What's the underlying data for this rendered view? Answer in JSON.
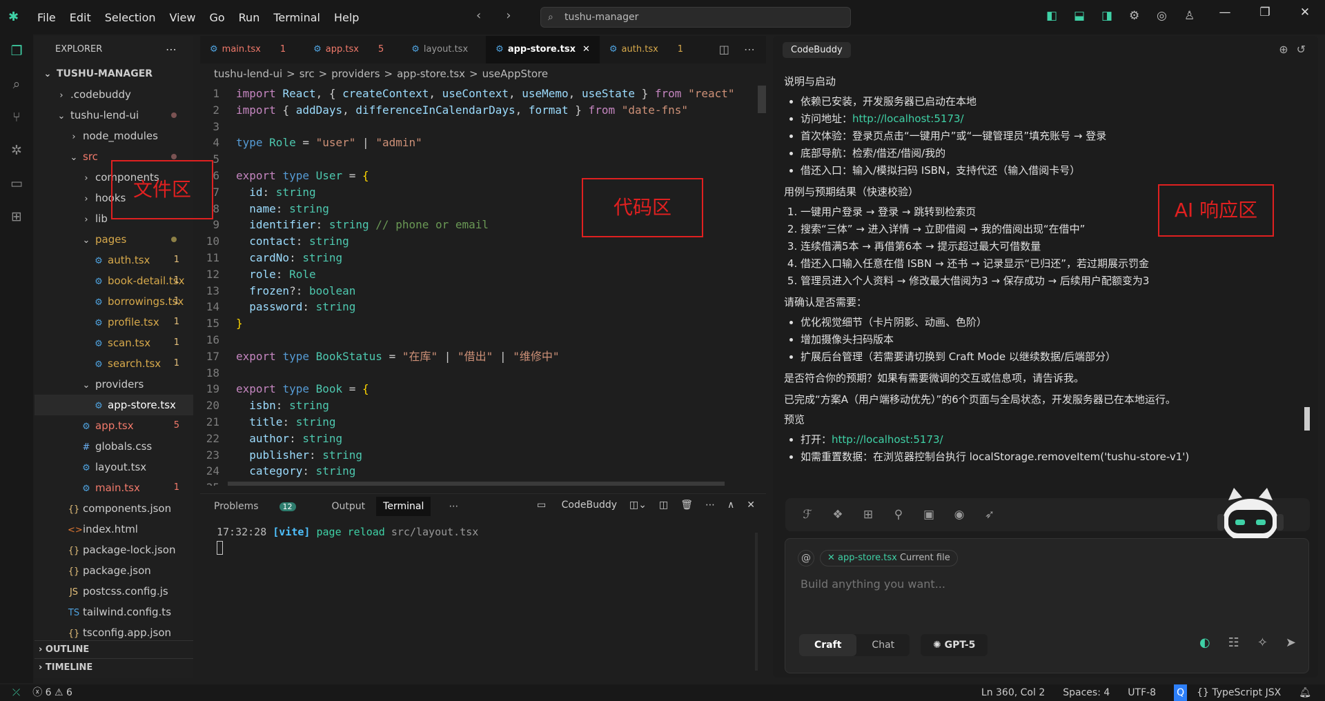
{
  "window": {
    "search": "tushu-manager",
    "menu": [
      "File",
      "Edit",
      "Selection",
      "View",
      "Go",
      "Run",
      "Terminal",
      "Help"
    ]
  },
  "explorer": {
    "header": "EXPLORER",
    "root": "TUSHU-MANAGER",
    "rows": [
      {
        "name": ".codebuddy",
        "indent": 1,
        "type": "folder",
        "open": false
      },
      {
        "name": "tushu-lend-ui",
        "indent": 1,
        "type": "folder",
        "open": true,
        "dot": "r"
      },
      {
        "name": "node_modules",
        "indent": 2,
        "type": "folder",
        "open": false
      },
      {
        "name": "src",
        "indent": 2,
        "type": "folder",
        "open": true,
        "dot": "r",
        "color": "err"
      },
      {
        "name": "components",
        "indent": 3,
        "type": "folder",
        "open": false
      },
      {
        "name": "hooks",
        "indent": 3,
        "type": "folder",
        "open": false
      },
      {
        "name": "lib",
        "indent": 3,
        "type": "folder",
        "open": false
      },
      {
        "name": "pages",
        "indent": 3,
        "type": "folder",
        "open": true,
        "dot": "y",
        "color": "warn"
      },
      {
        "name": "auth.tsx",
        "indent": 4,
        "type": "tsx",
        "num": "1",
        "color": "warn"
      },
      {
        "name": "book-detail.tsx",
        "indent": 4,
        "type": "tsx",
        "num": "1",
        "color": "warn"
      },
      {
        "name": "borrowings.tsx",
        "indent": 4,
        "type": "tsx",
        "num": "1",
        "color": "warn"
      },
      {
        "name": "profile.tsx",
        "indent": 4,
        "type": "tsx",
        "num": "1",
        "color": "warn"
      },
      {
        "name": "scan.tsx",
        "indent": 4,
        "type": "tsx",
        "num": "1",
        "color": "warn"
      },
      {
        "name": "search.tsx",
        "indent": 4,
        "type": "tsx",
        "num": "1",
        "color": "warn"
      },
      {
        "name": "providers",
        "indent": 3,
        "type": "folder",
        "open": true
      },
      {
        "name": "app-store.tsx",
        "indent": 4,
        "type": "tsx",
        "selected": true
      },
      {
        "name": "app.tsx",
        "indent": 3,
        "type": "tsx",
        "num": "5",
        "color": "err"
      },
      {
        "name": "globals.css",
        "indent": 3,
        "type": "css"
      },
      {
        "name": "layout.tsx",
        "indent": 3,
        "type": "tsx"
      },
      {
        "name": "main.tsx",
        "indent": 3,
        "type": "tsx",
        "num": "1",
        "color": "err"
      },
      {
        "name": "components.json",
        "indent": 2,
        "type": "json"
      },
      {
        "name": "index.html",
        "indent": 2,
        "type": "html"
      },
      {
        "name": "package-lock.json",
        "indent": 2,
        "type": "json"
      },
      {
        "name": "package.json",
        "indent": 2,
        "type": "json"
      },
      {
        "name": "postcss.config.js",
        "indent": 2,
        "type": "js"
      },
      {
        "name": "tailwind.config.ts",
        "indent": 2,
        "type": "ts"
      },
      {
        "name": "tsconfig.app.json",
        "indent": 2,
        "type": "json"
      }
    ],
    "outline": "OUTLINE",
    "timeline": "TIMELINE"
  },
  "editor": {
    "tabs": [
      {
        "name": "main.tsx",
        "num": "1",
        "state": "err"
      },
      {
        "name": "app.tsx",
        "num": "5",
        "state": "err"
      },
      {
        "name": "layout.tsx",
        "num": "",
        "state": ""
      },
      {
        "name": "app-store.tsx",
        "num": "",
        "state": "active"
      },
      {
        "name": "auth.tsx",
        "num": "1",
        "state": "warn"
      }
    ],
    "breadcrumb": [
      "tushu-lend-ui",
      ">",
      "src",
      ">",
      "providers",
      ">",
      "app-store.tsx",
      ">",
      "useAppStore"
    ],
    "lines": [
      [
        [
          "kw2",
          "import "
        ],
        [
          "id",
          "React"
        ],
        [
          "pl",
          ", { "
        ],
        [
          "id",
          "createContext"
        ],
        [
          "pl",
          ", "
        ],
        [
          "id",
          "useContext"
        ],
        [
          "pl",
          ", "
        ],
        [
          "id",
          "useMemo"
        ],
        [
          "pl",
          ", "
        ],
        [
          "id",
          "useState"
        ],
        [
          "pl",
          " } "
        ],
        [
          "kw2",
          "from "
        ],
        [
          "str",
          "\"react\""
        ]
      ],
      [
        [
          "kw2",
          "import "
        ],
        [
          "pl",
          "{ "
        ],
        [
          "id",
          "addDays"
        ],
        [
          "pl",
          ", "
        ],
        [
          "id",
          "differenceInCalendarDays"
        ],
        [
          "pl",
          ", "
        ],
        [
          "id",
          "format"
        ],
        [
          "pl",
          " } "
        ],
        [
          "kw2",
          "from "
        ],
        [
          "str",
          "\"date-fns\""
        ]
      ],
      [],
      [
        [
          "kw",
          "type "
        ],
        [
          "ty",
          "Role"
        ],
        [
          "pl",
          " = "
        ],
        [
          "str",
          "\"user\""
        ],
        [
          "pl",
          " | "
        ],
        [
          "str",
          "\"admin\""
        ]
      ],
      [],
      [
        [
          "kw2",
          "export "
        ],
        [
          "kw",
          "type "
        ],
        [
          "ty",
          "User"
        ],
        [
          "pl",
          " = "
        ],
        [
          "yl",
          "{"
        ]
      ],
      [
        [
          "pl",
          "  "
        ],
        [
          "id",
          "id"
        ],
        [
          "pl",
          ": "
        ],
        [
          "ty",
          "string"
        ]
      ],
      [
        [
          "pl",
          "  "
        ],
        [
          "id",
          "name"
        ],
        [
          "pl",
          ": "
        ],
        [
          "ty",
          "string"
        ]
      ],
      [
        [
          "pl",
          "  "
        ],
        [
          "id",
          "identifier"
        ],
        [
          "pl",
          ": "
        ],
        [
          "ty",
          "string "
        ],
        [
          "cm",
          "// phone or email"
        ]
      ],
      [
        [
          "pl",
          "  "
        ],
        [
          "id",
          "contact"
        ],
        [
          "pl",
          ": "
        ],
        [
          "ty",
          "string"
        ]
      ],
      [
        [
          "pl",
          "  "
        ],
        [
          "id",
          "cardNo"
        ],
        [
          "pl",
          ": "
        ],
        [
          "ty",
          "string"
        ]
      ],
      [
        [
          "pl",
          "  "
        ],
        [
          "id",
          "role"
        ],
        [
          "pl",
          ": "
        ],
        [
          "ty",
          "Role"
        ]
      ],
      [
        [
          "pl",
          "  "
        ],
        [
          "id",
          "frozen"
        ],
        [
          "pl",
          "?: "
        ],
        [
          "ty",
          "boolean"
        ]
      ],
      [
        [
          "pl",
          "  "
        ],
        [
          "id",
          "password"
        ],
        [
          "pl",
          ": "
        ],
        [
          "ty",
          "string"
        ]
      ],
      [
        [
          "yl",
          "}"
        ]
      ],
      [],
      [
        [
          "kw2",
          "export "
        ],
        [
          "kw",
          "type "
        ],
        [
          "ty",
          "BookStatus"
        ],
        [
          "pl",
          " = "
        ],
        [
          "str",
          "\"在库\""
        ],
        [
          "pl",
          " | "
        ],
        [
          "str",
          "\"借出\""
        ],
        [
          "pl",
          " | "
        ],
        [
          "str",
          "\"维修中\""
        ]
      ],
      [],
      [
        [
          "kw2",
          "export "
        ],
        [
          "kw",
          "type "
        ],
        [
          "ty",
          "Book"
        ],
        [
          "pl",
          " = "
        ],
        [
          "yl",
          "{"
        ]
      ],
      [
        [
          "pl",
          "  "
        ],
        [
          "id",
          "isbn"
        ],
        [
          "pl",
          ": "
        ],
        [
          "ty",
          "string"
        ]
      ],
      [
        [
          "pl",
          "  "
        ],
        [
          "id",
          "title"
        ],
        [
          "pl",
          ": "
        ],
        [
          "ty",
          "string"
        ]
      ],
      [
        [
          "pl",
          "  "
        ],
        [
          "id",
          "author"
        ],
        [
          "pl",
          ": "
        ],
        [
          "ty",
          "string"
        ]
      ],
      [
        [
          "pl",
          "  "
        ],
        [
          "id",
          "publisher"
        ],
        [
          "pl",
          ": "
        ],
        [
          "ty",
          "string"
        ]
      ],
      [
        [
          "pl",
          "  "
        ],
        [
          "id",
          "category"
        ],
        [
          "pl",
          ": "
        ],
        [
          "ty",
          "string"
        ]
      ],
      [
        [
          "pl",
          "  "
        ],
        [
          "id",
          "stock"
        ],
        [
          "pl",
          ": "
        ],
        [
          "ty",
          "number"
        ]
      ]
    ]
  },
  "panel": {
    "tabs": [
      "Problems",
      "Output",
      "Terminal"
    ],
    "problems_count": "12",
    "right_label": "CodeBuddy",
    "term_time": "17:32:28",
    "term_tag": "[vite]",
    "term_msg": "page reload",
    "term_file": "src/layout.tsx"
  },
  "ai": {
    "tab": "CodeBuddy",
    "s1_title": "说明与启动",
    "s1": [
      {
        "t": "依赖已安装，开发服务器已启动在本地"
      },
      {
        "t": "访问地址：",
        "link": "http://localhost:5173/"
      },
      {
        "t": "首次体验：登录页点击“一键用户”或“一键管理员”填充账号 → 登录"
      },
      {
        "t": "底部导航：检索/借还/借阅/我的"
      },
      {
        "t": "借还入口：输入/模拟扫码 ISBN，支持代还（输入借阅卡号）"
      }
    ],
    "s2_title": "用例与预期结果（快速校验）",
    "s2": [
      "一键用户登录 → 登录 → 跳转到检索页",
      "搜索“三体” → 进入详情 → 立即借阅 → 我的借阅出现“在借中”",
      "连续借满5本 → 再借第6本 → 提示超过最大可借数量",
      "借还入口输入任意在借 ISBN → 还书 → 记录显示“已归还”，若过期展示罚金",
      "管理员进入个人资料 → 修改最大借阅为3 → 保存成功 → 后续用户配额变为3"
    ],
    "s3_title": "请确认是否需要：",
    "s3": [
      "优化视觉细节（卡片阴影、动画、色阶）",
      "增加摄像头扫码版本",
      "扩展后台管理（若需要请切换到 Craft Mode 以继续数据/后端部分）"
    ],
    "p1": "是否符合你的预期？如果有需要微调的交互或信息项，请告诉我。",
    "p2": "已完成“方案A（用户端移动优先）”的6个页面与全局状态，开发服务器已在本地运行。",
    "s4_title": "预览",
    "s4": [
      {
        "t": "打开：",
        "link": "http://localhost:5173/"
      },
      {
        "t": "如需重置数据：在浏览器控制台执行 localStorage.removeItem('tushu-store-v1')"
      }
    ],
    "ctx_file": "app-store.tsx",
    "ctx_label": "Current file",
    "at": "@",
    "placeholder": "Build anything you want...",
    "mode_craft": "Craft",
    "mode_chat": "Chat",
    "model": "GPT-5"
  },
  "status": {
    "errors": "6",
    "warnings": "6",
    "position": "Ln 360, Col 2",
    "spaces": "Spaces: 4",
    "encoding": "UTF-8",
    "lang": "{} TypeScript JSX"
  },
  "annotations": {
    "files": "文件区",
    "code": "代码区",
    "ai": "AI 响应区"
  }
}
